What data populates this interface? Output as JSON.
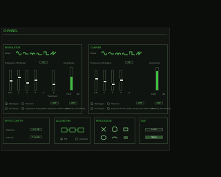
{
  "app": {
    "title": "CHANNEL"
  },
  "modulator": {
    "title": "MODULATOR",
    "wave_label": "Wave",
    "freq_label": "Frequency Multiplier",
    "amp_label": "Amplitude",
    "dd_value": "x2",
    "feedback_label": "Feedback",
    "ticks": [
      "0.5",
      "1",
      "2",
      "3",
      "4"
    ],
    "feedback_value": "0",
    "meter_left": "7.18",
    "meter_right": "40",
    "options": [
      {
        "label": "Retrigger",
        "on": true
      },
      {
        "label": "Envelope",
        "on": false
      }
    ],
    "sub_labels": [
      {
        "label": "Keyboard Freq. Ratio"
      },
      {
        "label": "Keyboard Attenuation"
      },
      {
        "label": "Velocity Sensitivity"
      }
    ],
    "sub_values": [
      "OFF",
      "OFF"
    ]
  },
  "carrier": {
    "title": "CARRIER",
    "wave_label": "Wave",
    "freq_label": "Frequency Multiplier",
    "amp_label": "Amplitude",
    "dd_value": "x1",
    "ticks": [
      "0.5",
      "1",
      "2",
      "3",
      "4"
    ],
    "meter_left": "0.00",
    "meter_right": "40",
    "options": [
      {
        "label": "Retrigger",
        "on": true
      },
      {
        "label": "Envelope",
        "on": false
      }
    ],
    "sub_labels": [
      {
        "label": "Keyboard Freq. Ratio"
      },
      {
        "label": "Keyboard Attenuation"
      },
      {
        "label": "Velocity Sensitivity"
      }
    ],
    "sub_values": [
      "OFF",
      "OFF"
    ]
  },
  "effects": {
    "effect_depth": {
      "title": "EFFECT DEPTH",
      "rows": [
        {
          "label": "Tremolo",
          "value": "1.0 dB"
        },
        {
          "label": "Vibrato",
          "value": "7 cents"
        }
      ]
    },
    "algorithm": {
      "title": "ALGORITHM",
      "left": "FM",
      "right": "Additive"
    },
    "percussion": {
      "title": "PERCUSSION"
    },
    "file": {
      "title": "FILE",
      "load": "Load",
      "save": "Save"
    }
  }
}
